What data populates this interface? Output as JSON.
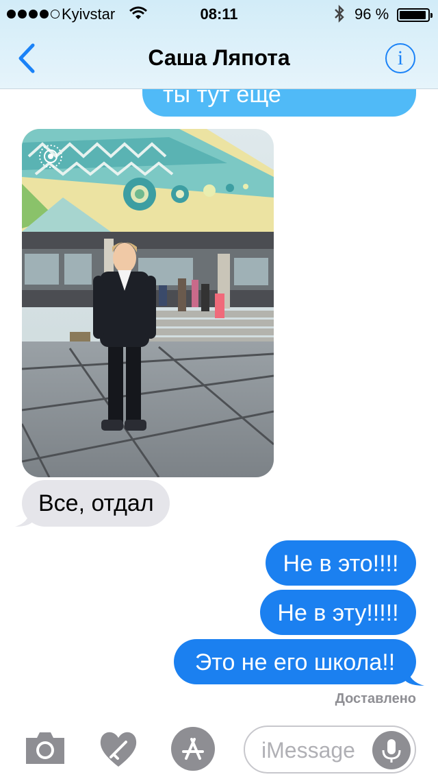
{
  "status_bar": {
    "carrier": "Kyivstar",
    "time": "08:11",
    "battery_percent": "96 %",
    "battery_level": 0.96,
    "signal_bars": 4
  },
  "nav": {
    "title": "Саша Ляпота",
    "info_icon": "i"
  },
  "messages": [
    {
      "direction": "outgoing",
      "text": "ты тут еще",
      "partially_visible": true
    },
    {
      "direction": "incoming",
      "type": "photo",
      "icon": "live-photo-icon"
    },
    {
      "direction": "incoming",
      "text": "Все, отдал"
    },
    {
      "direction": "outgoing",
      "text": "Не в это!!!!"
    },
    {
      "direction": "outgoing",
      "text": "Не в эту!!!!!"
    },
    {
      "direction": "outgoing",
      "text": "Это не его школа!!"
    }
  ],
  "delivered_label": "Доставлено",
  "input_bar": {
    "placeholder": "iMessage",
    "icons": [
      "camera-icon",
      "digital-touch-heart-icon",
      "app-store-icon",
      "microphone-icon"
    ]
  },
  "colors": {
    "outgoing_bubble": "#1b80f0",
    "incoming_bubble": "#e5e5ea",
    "accent": "#1a82f7",
    "header_bg": "#d2ecf8"
  }
}
